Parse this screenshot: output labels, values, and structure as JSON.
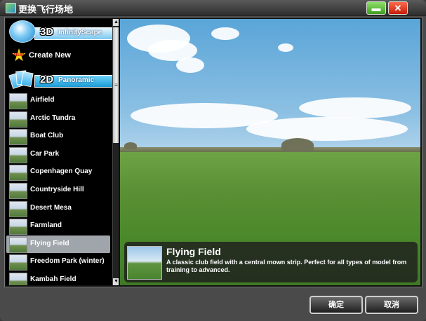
{
  "window": {
    "title": "更换飞行场地",
    "min_glyph": "▬",
    "close_glyph": "✕"
  },
  "categories": {
    "infinityscape": {
      "badge": "3D",
      "label": "InfinityScape"
    },
    "create_new": {
      "star_text": "NEW",
      "label": "Create New"
    },
    "panoramic": {
      "badge": "2D",
      "label": "Panoramic"
    }
  },
  "fields": [
    {
      "name": "Airfield"
    },
    {
      "name": "Arctic Tundra"
    },
    {
      "name": "Boat Club"
    },
    {
      "name": "Car Park"
    },
    {
      "name": "Copenhagen Quay"
    },
    {
      "name": "Countryside Hill"
    },
    {
      "name": "Desert Mesa"
    },
    {
      "name": "Farmland"
    },
    {
      "name": "Flying Field"
    },
    {
      "name": "Freedom Park (winter)"
    },
    {
      "name": "Kambah Field"
    }
  ],
  "selected_index": 8,
  "scrollbar": {
    "up": "▲",
    "down": "▼",
    "grip": "≡"
  },
  "preview": {
    "title": "Flying Field",
    "description": "A classic club field with a central mown strip. Perfect for all types of model from training to advanced."
  },
  "buttons": {
    "ok": "确定",
    "cancel": "取消"
  }
}
